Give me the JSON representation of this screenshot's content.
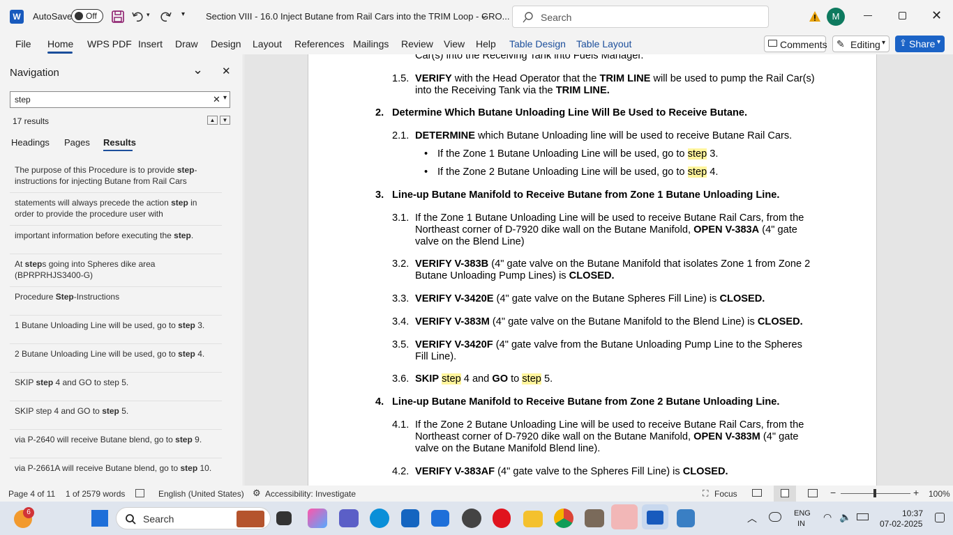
{
  "titlebar": {
    "autosave": "AutoSave",
    "autosave_state": "Off",
    "title": "Section VIII - 16.0 Inject Butane from Rail Cars into the TRIM Loop - GRO...",
    "search": "Search",
    "avatar": "M"
  },
  "ribbon": {
    "tabs": [
      "File",
      "Home",
      "WPS PDF",
      "Insert",
      "Draw",
      "Design",
      "Layout",
      "References",
      "Mailings",
      "Review",
      "View",
      "Help",
      "Table Design",
      "Table Layout"
    ],
    "comments": "Comments",
    "editing": "Editing",
    "share": "Share"
  },
  "nav": {
    "title": "Navigation",
    "query": "step",
    "count": "17 results",
    "tabs": [
      "Headings",
      "Pages",
      "Results"
    ],
    "results": [
      [
        "The purpose of this Procedure is to provide ",
        "step",
        "-\ninstructions for injecting Butane from Rail Cars"
      ],
      [
        "statements will always precede the action ",
        "step",
        " in\norder to provide the procedure user with"
      ],
      [
        "important information before executing the ",
        "step",
        "."
      ],
      [
        "At ",
        "step",
        "s going into Spheres dike area\n(BPRPRHJS3400-G)"
      ],
      [
        "Procedure ",
        "Step",
        "-Instructions"
      ],
      [
        "1 Butane Unloading Line will be used, go to ",
        "step",
        " 3."
      ],
      [
        "2 Butane Unloading Line will be used, go to ",
        "step",
        " 4."
      ],
      [
        "SKIP ",
        "step",
        " 4 and GO to step 5."
      ],
      [
        "SKIP step 4 and GO to ",
        "step",
        " 5."
      ],
      [
        "via P-2640 will receive Butane blend, go to ",
        "step",
        " 9."
      ],
      [
        "via P-2661A will receive Butane blend, go to ",
        "step",
        " 10."
      ]
    ]
  },
  "doc": {
    "top_line": "Car(s) into the Receiving Tank into Fuels Manager.",
    "s1_5": {
      "num": "1.5.",
      "a": "VERIFY",
      "b": " with the Head Operator that the ",
      "c": "TRIM LINE",
      "d": " will be used to pump the Rail Car(s)",
      "e": "into the Receiving Tank via the ",
      "f": "TRIM LINE."
    },
    "h2": {
      "num": "2.",
      "text": "Determine Which Butane Unloading Line Will Be Used to Receive Butane."
    },
    "s2_1": {
      "num": "2.1.",
      "a": "DETERMINE",
      "b": " which Butane Unloading line will be used to receive Butane Rail Cars."
    },
    "b1": {
      "a": "If the Zone 1 Butane Unloading Line will be used, go to ",
      "hl": "step",
      "c": " 3."
    },
    "b2": {
      "a": "If the Zone 2 Butane Unloading Line will be used, go to ",
      "hl": "step",
      "c": " 4."
    },
    "h3": {
      "num": "3.",
      "text": "Line-up Butane Manifold to Receive Butane from Zone 1 Butane Unloading Line."
    },
    "s3_1": {
      "num": "3.1.",
      "l1": "If the Zone 1 Butane Unloading Line will be used to receive Butane Rail Cars, from the",
      "l2a": "Northeast corner of D-7920 dike wall on the Butane Manifold, ",
      "l2b": "OPEN V-383A",
      "l2c": " (4\" gate",
      "l3": "valve on the Blend Line)"
    },
    "s3_2": {
      "num": "3.2.",
      "a": "VERIFY V-383B",
      "b": " (4\" gate valve on the Butane Manifold that isolates Zone 1 from Zone 2",
      "c": "Butane Unloading Pump Lines) is ",
      "d": "CLOSED."
    },
    "s3_3": {
      "num": "3.3.",
      "a": "VERIFY V-3420E",
      "b": " (4\" gate valve on the Butane Spheres Fill Line) is ",
      "c": "CLOSED."
    },
    "s3_4": {
      "num": "3.4.",
      "a": "VERIFY V-383M",
      "b": " (4\" gate valve on the Butane Manifold to the Blend Line) is ",
      "c": "CLOSED."
    },
    "s3_5": {
      "num": "3.5.",
      "a": "VERIFY V-3420F",
      "b": " (4\" gate valve from the Butane Unloading Pump Line to the Spheres",
      "c": "Fill Line)."
    },
    "s3_6": {
      "num": "3.6.",
      "a": "SKIP",
      "b": " ",
      "hl1": "step",
      "c": " 4 and ",
      "d": "GO",
      "e": " to ",
      "hl2": "step",
      "f": " 5."
    },
    "h4": {
      "num": "4.",
      "text": "Line-up Butane Manifold to Receive Butane from Zone 2 Butane Unloading Line."
    },
    "s4_1": {
      "num": "4.1.",
      "l1": "If the Zone 2 Butane Unloading Line will be used to receive Butane Rail Cars, from the",
      "l2a": "Northeast corner of D-7920 dike wall on the Butane Manifold, ",
      "l2b": "OPEN V-383M",
      "l2c": " (4\" gate",
      "l3": "valve on the Butane Manifold Blend line)."
    },
    "s4_2": {
      "num": "4.2.",
      "a": "VERIFY V-383AF",
      "b": " (4\" gate valve to the Spheres Fill Line) is ",
      "c": "CLOSED."
    }
  },
  "status": {
    "page": "Page 4 of 11",
    "words": "1 of 2579 words",
    "lang": "English (United States)",
    "access": "Accessibility: Investigate",
    "focus": "Focus",
    "zoom": "100%"
  },
  "taskbar": {
    "search": "Search",
    "badge": "6",
    "lang1": "ENG",
    "lang2": "IN",
    "time": "10:37",
    "date": "07-02-2025"
  }
}
